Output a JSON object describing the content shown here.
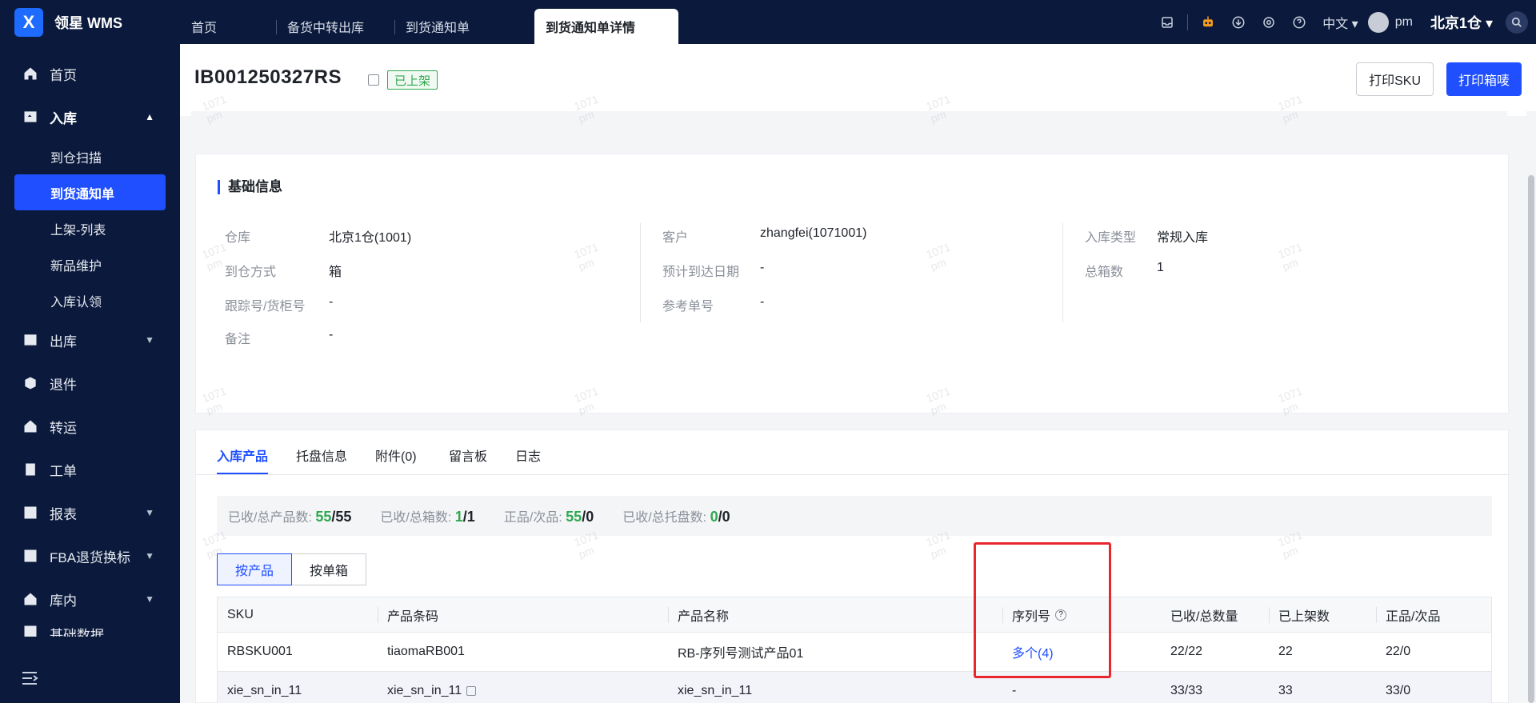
{
  "app": {
    "name": "领星 WMS",
    "logo_letter": "X"
  },
  "tabs": [
    {
      "label": "首页",
      "active": false
    },
    {
      "label": "备货中转出库",
      "active": false
    },
    {
      "label": "到货通知单",
      "active": false
    },
    {
      "label": "到货通知单详情",
      "active": true
    }
  ],
  "topbar": {
    "language": "中文",
    "user": "pm",
    "warehouse": "北京1仓"
  },
  "sidebar": {
    "items": [
      {
        "label": "首页",
        "icon": "home-icon"
      },
      {
        "label": "入库",
        "icon": "inbound-icon",
        "open": true,
        "children": [
          "到仓扫描",
          "到货通知单",
          "上架-列表",
          "新品维护",
          "入库认领"
        ]
      },
      {
        "label": "出库",
        "icon": "outbound-icon"
      },
      {
        "label": "退件",
        "icon": "return-icon"
      },
      {
        "label": "转运",
        "icon": "transfer-icon"
      },
      {
        "label": "工单",
        "icon": "workorder-icon"
      },
      {
        "label": "报表",
        "icon": "report-icon"
      },
      {
        "label": "FBA退货换标",
        "icon": "fba-icon"
      },
      {
        "label": "库内",
        "icon": "warehouse-icon"
      },
      {
        "label": "基础数据",
        "icon": "data-icon"
      }
    ],
    "active_child": "到货通知单"
  },
  "header": {
    "doc_no": "IB001250327RS",
    "status": "已上架",
    "btn_print_sku": "打印SKU",
    "btn_print_box": "打印箱唛"
  },
  "basic": {
    "title": "基础信息",
    "col1": [
      {
        "label": "仓库",
        "value": "北京1仓(1001)"
      },
      {
        "label": "到仓方式",
        "value": "箱"
      },
      {
        "label": "跟踪号/货柜号",
        "value": "-"
      },
      {
        "label": "备注",
        "value": "-"
      }
    ],
    "col2": [
      {
        "label": "客户",
        "value": "zhangfei(1071001)"
      },
      {
        "label": "预计到达日期",
        "value": "-"
      },
      {
        "label": "参考单号",
        "value": "-"
      }
    ],
    "col3": [
      {
        "label": "入库类型",
        "value": "常规入库"
      },
      {
        "label": "总箱数",
        "value": "1"
      }
    ]
  },
  "product_tabs": [
    "入库产品",
    "托盘信息",
    "附件(0)",
    "留言板",
    "日志"
  ],
  "stats": [
    {
      "label": "已收/总产品数:",
      "a": "55",
      "b": "/55"
    },
    {
      "label": "已收/总箱数:",
      "a": "1",
      "b": "/1"
    },
    {
      "label": "正品/次品:",
      "a": "55",
      "b": "/0"
    },
    {
      "label": "已收/总托盘数:",
      "a": "0",
      "b": "/0"
    }
  ],
  "view_toggle": [
    "按产品",
    "按单箱"
  ],
  "table": {
    "columns": [
      "SKU",
      "产品条码",
      "产品名称",
      "序列号",
      "已收/总数量",
      "已上架数",
      "正品/次品"
    ],
    "rows": [
      [
        "RBSKU001",
        "tiaomaRB001",
        "RB-序列号测试产品01",
        "多个(4)",
        "22/22",
        "22",
        "22/0"
      ],
      [
        "xie_sn_in_11",
        "xie_sn_in_11",
        "xie_sn_in_11",
        "-",
        "33/33",
        "33",
        "33/0"
      ]
    ]
  },
  "watermark": {
    "l1": "1071",
    "l2": "pm"
  }
}
